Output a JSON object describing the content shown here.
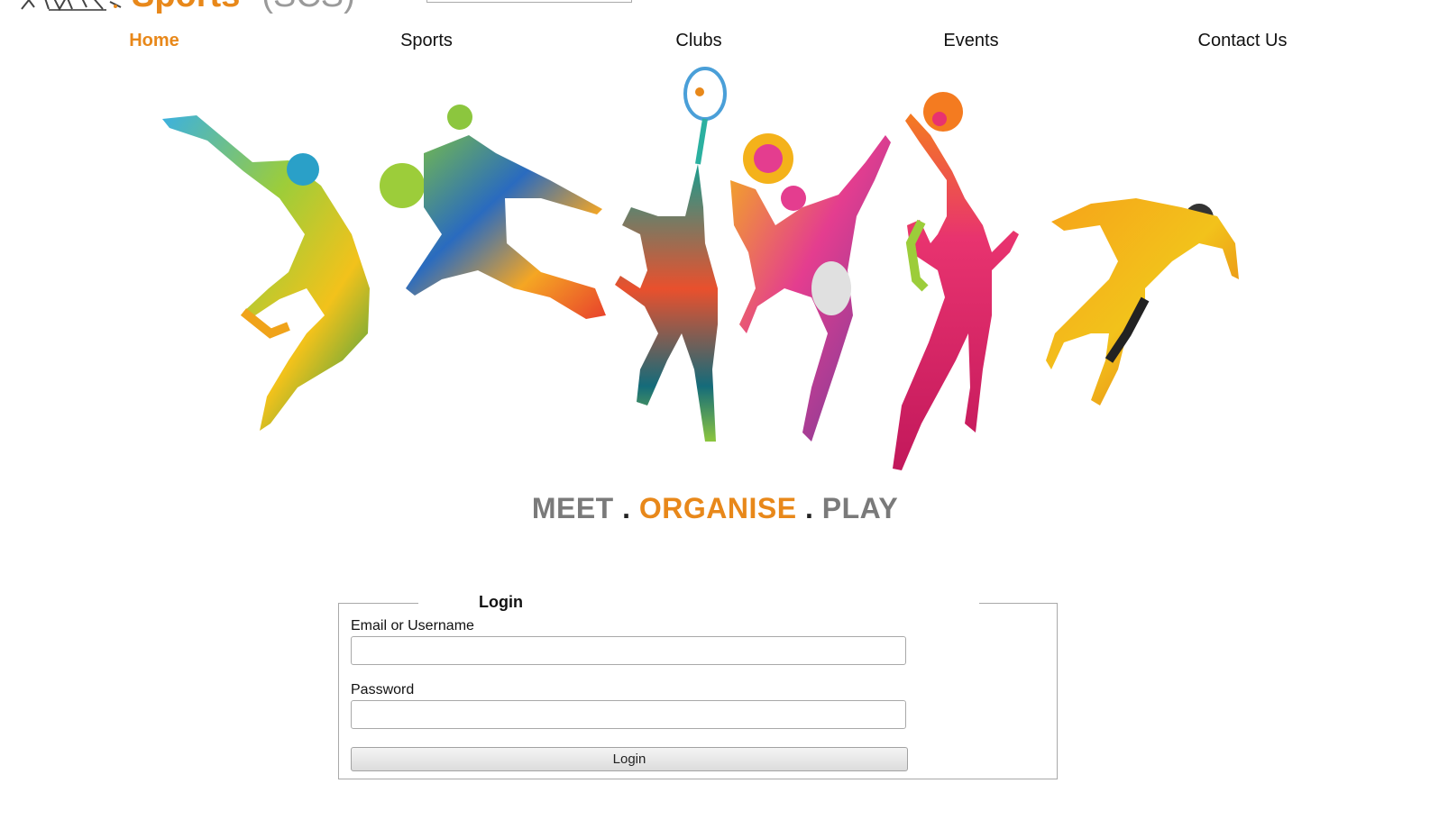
{
  "header": {
    "logo_text": "Sports",
    "logo_sub": "(SCS)"
  },
  "nav": {
    "items": [
      {
        "label": "Home",
        "active": true
      },
      {
        "label": "Sports",
        "active": false
      },
      {
        "label": "Clubs",
        "active": false
      },
      {
        "label": "Events",
        "active": false
      },
      {
        "label": "Contact Us",
        "active": false
      }
    ]
  },
  "tagline": {
    "part1": "MEET",
    "sep1": " . ",
    "part2": "ORGANISE",
    "sep2": " . ",
    "part3": "PLAY"
  },
  "login": {
    "legend": "Login",
    "username_label": "Email or Username",
    "username_value": "",
    "password_label": "Password",
    "password_value": "",
    "button_label": "Login"
  },
  "colors": {
    "accent": "#e8881a",
    "muted": "#7a7a7a"
  }
}
